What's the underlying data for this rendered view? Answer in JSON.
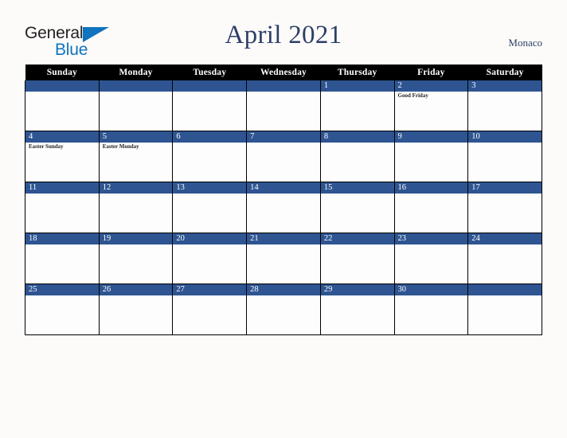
{
  "brand": {
    "name_part1": "General",
    "name_part2": "Blue",
    "triangle_color": "#1073bd",
    "text_color": "#231f20"
  },
  "header": {
    "title": "April 2021",
    "locale": "Monaco",
    "title_color": "#2d3f66"
  },
  "calendar": {
    "accent_color": "#2e5592",
    "header_bg": "#000000",
    "weekday_headers": [
      "Sunday",
      "Monday",
      "Tuesday",
      "Wednesday",
      "Thursday",
      "Friday",
      "Saturday"
    ],
    "weeks": [
      [
        {
          "day": "",
          "events": []
        },
        {
          "day": "",
          "events": []
        },
        {
          "day": "",
          "events": []
        },
        {
          "day": "",
          "events": []
        },
        {
          "day": "1",
          "events": []
        },
        {
          "day": "2",
          "events": [
            "Good Friday"
          ]
        },
        {
          "day": "3",
          "events": []
        }
      ],
      [
        {
          "day": "4",
          "events": [
            "Easter Sunday"
          ]
        },
        {
          "day": "5",
          "events": [
            "Easter Monday"
          ]
        },
        {
          "day": "6",
          "events": []
        },
        {
          "day": "7",
          "events": []
        },
        {
          "day": "8",
          "events": []
        },
        {
          "day": "9",
          "events": []
        },
        {
          "day": "10",
          "events": []
        }
      ],
      [
        {
          "day": "11",
          "events": []
        },
        {
          "day": "12",
          "events": []
        },
        {
          "day": "13",
          "events": []
        },
        {
          "day": "14",
          "events": []
        },
        {
          "day": "15",
          "events": []
        },
        {
          "day": "16",
          "events": []
        },
        {
          "day": "17",
          "events": []
        }
      ],
      [
        {
          "day": "18",
          "events": []
        },
        {
          "day": "19",
          "events": []
        },
        {
          "day": "20",
          "events": []
        },
        {
          "day": "21",
          "events": []
        },
        {
          "day": "22",
          "events": []
        },
        {
          "day": "23",
          "events": []
        },
        {
          "day": "24",
          "events": []
        }
      ],
      [
        {
          "day": "25",
          "events": []
        },
        {
          "day": "26",
          "events": []
        },
        {
          "day": "27",
          "events": []
        },
        {
          "day": "28",
          "events": []
        },
        {
          "day": "29",
          "events": []
        },
        {
          "day": "30",
          "events": []
        },
        {
          "day": "",
          "events": []
        }
      ]
    ]
  }
}
